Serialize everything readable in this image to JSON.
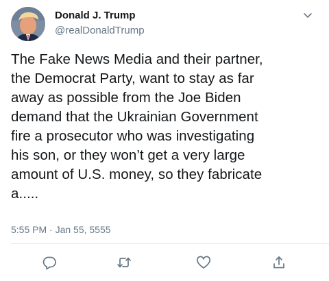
{
  "author": {
    "display_name": "Donald J. Trump",
    "handle": "@realDonaldTrump"
  },
  "tweet": {
    "lines": [
      "The Fake News Media and their partner,",
      "the Democrat Party, want to stay as far",
      "away as possible from the Joe Biden",
      "demand that the Ukrainian Government",
      "fire a prosecutor who was investigating",
      "his son, or they won’t get a very large",
      "amount of U.S. money, so they fabricate",
      "a....."
    ],
    "timestamp": "5:55 PM · Jan 55, 5555"
  },
  "icons": {
    "avatar": "profile-photo",
    "menu": "chevron-down-icon",
    "reply": "reply-icon",
    "retweet": "retweet-icon",
    "like": "heart-icon",
    "share": "share-icon"
  },
  "colors": {
    "text": "#14171a",
    "secondary": "#657786",
    "divider": "#e6ecf0"
  }
}
